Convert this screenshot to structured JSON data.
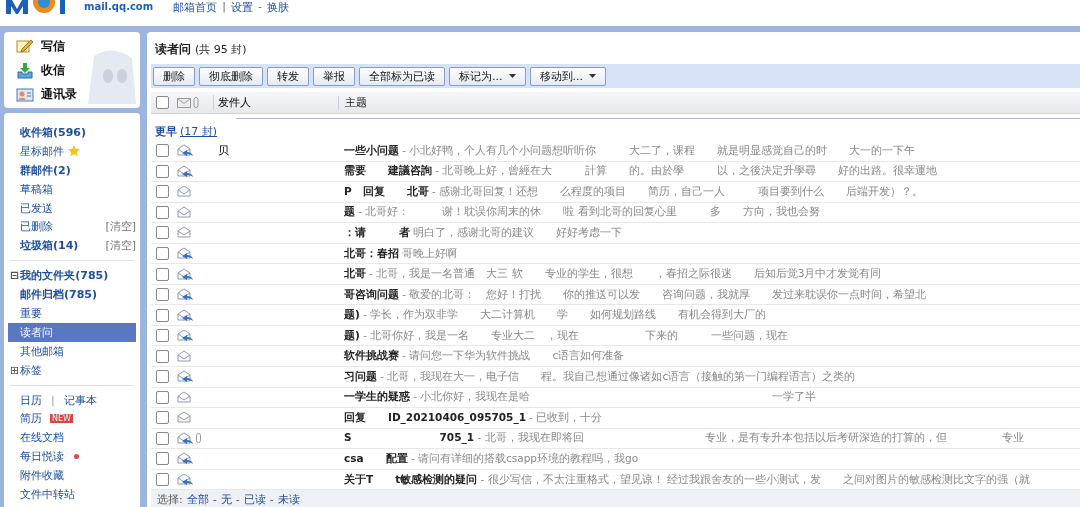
{
  "header": {
    "site": "mail.qq.com",
    "links": [
      "邮箱首页",
      "设置",
      "换肤"
    ],
    "separators": [
      "|",
      "-"
    ]
  },
  "compose": [
    {
      "kind": "write",
      "label": "写信"
    },
    {
      "kind": "receive",
      "label": "收信"
    },
    {
      "kind": "contacts",
      "label": "通讯录"
    }
  ],
  "folders": [
    {
      "label": "收件箱(596)",
      "unread": true,
      "selected": false
    },
    {
      "label": "星标邮件",
      "unread": false,
      "selected": false,
      "starred": true
    },
    {
      "label": "群邮件(2)",
      "unread": true,
      "selected": false
    },
    {
      "label": "草稿箱",
      "unread": false,
      "selected": false
    },
    {
      "label": "已发送",
      "unread": false,
      "selected": false
    },
    {
      "label": "已删除",
      "unread": false,
      "selected": false,
      "action": "[清空]"
    },
    {
      "label": "垃圾箱(14)",
      "unread": true,
      "selected": false,
      "action": "[清空]"
    }
  ],
  "my_folders": [
    {
      "label": "我的文件夹(785)",
      "unread": true,
      "selected": false,
      "toggle": "⊟",
      "children": [
        {
          "label": "邮件归档(785)",
          "unread": true,
          "selected": false
        },
        {
          "label": "重要",
          "unread": false,
          "selected": false
        },
        {
          "label": "读者问",
          "unread": false,
          "selected": true
        }
      ]
    },
    {
      "label": "其他邮箱",
      "unread": false,
      "selected": false
    },
    {
      "label": "标签",
      "unread": false,
      "selected": false,
      "toggle": "⊞"
    }
  ],
  "tools": [
    {
      "links": [
        "日历",
        "记事本"
      ],
      "separator": "|"
    },
    {
      "links": [
        "简历"
      ],
      "badge": "NEW"
    },
    {
      "links": [
        "在线文档"
      ]
    },
    {
      "links": [
        "每日悦读"
      ],
      "dot": true
    },
    {
      "links": [
        "附件收藏"
      ]
    },
    {
      "links": [
        "文件中转站"
      ]
    }
  ],
  "folder_title": {
    "name": "读者问",
    "count": "(共 95 封)"
  },
  "toolbar": [
    {
      "label": "删除"
    },
    {
      "label": "彻底删除"
    },
    {
      "label": "转发"
    },
    {
      "label": "举报"
    },
    {
      "label": "全部标为已读"
    },
    {
      "label": "标记为...",
      "dropdown": true
    },
    {
      "label": "移动到...",
      "dropdown": true
    }
  ],
  "select_all": {
    "checked": false
  },
  "columns": [
    "发件人",
    "主题"
  ],
  "group": {
    "label": "更早",
    "count": "(17 封)"
  },
  "rows": [
    {
      "checked": false,
      "sender": "贝",
      "subject": "一些小问题",
      "preview": "- 小北好鸭，个人有几个小问题想听听你　　　大二了，课程　　就是明显感觉自己的时　　大一的一下午",
      "replied": true,
      "attachment": false
    },
    {
      "checked": false,
      "subject": "需要　　建議咨詢",
      "preview": "- 北哥晚上好，曾經在大　　　計算　　的。由於學　　　以，之後決定升學尋　　好的出路。很幸運地",
      "replied": true,
      "attachment": false
    },
    {
      "checked": false,
      "subject": "P　回复　　北哥",
      "preview": "- 感谢北哥回复！还想　　么程度的项目　　简历，自己一人　　　项目要到什么　　后端开发）？。",
      "replied": false,
      "attachment": false
    },
    {
      "checked": false,
      "subject": "题",
      "preview": "- 北哥好：　　　谢！耽误你周末的休　　啦 看到北哥的回复心里　　　多　　方向，我也会努",
      "replied": false,
      "attachment": false
    },
    {
      "checked": false,
      "subject": "：请　　　者",
      "preview": "明白了，感谢北哥的建议　　好好考虑一下",
      "replied": false,
      "attachment": false
    },
    {
      "checked": false,
      "subject": "北哥：春招",
      "preview": "哥晚上好啊",
      "replied": true,
      "attachment": false
    },
    {
      "checked": false,
      "subject": "北哥",
      "preview": "- 北哥，我是一名普通　大三 软　　专业的学生，很想　　，春招之际很迷　　后知后觉3月中才发觉有同",
      "replied": true,
      "attachment": false
    },
    {
      "checked": false,
      "subject": "哥咨询问题",
      "preview": "- 敬爱的北哥：　您好！打扰　　你的推送可以发　　咨询问题，我就厚　　发过来耽误你一点时间，希望北",
      "replied": true,
      "attachment": false
    },
    {
      "checked": false,
      "subject": "题)",
      "preview": "- 学长，作为双非学　　大二计算机　　学　　如何规划路线　　有机会得到大厂的",
      "replied": true,
      "attachment": false
    },
    {
      "checked": false,
      "subject": "题)",
      "preview": "- 北哥你好，我是一名　　专业大二　，现在　　　　　　下来的　　　一些问题，现在",
      "replied": true,
      "attachment": false
    },
    {
      "checked": false,
      "subject": "软件挑战赛",
      "preview": "- 请问您一下华为软件挑战　　c语言如何准备",
      "replied": false,
      "attachment": false
    },
    {
      "checked": false,
      "subject": "习问题",
      "preview": "- 北哥，我现在大一，电子信　　程。我自己想通过像诸如c语言（接触的第一门编程语言）之类的",
      "replied": true,
      "attachment": false
    },
    {
      "checked": false,
      "subject": "一学生的疑惑",
      "preview": "- 小北你好，我现在是哈　　　　　　　　　　　　　　　　　　　　　　一学了半",
      "replied": false,
      "attachment": false
    },
    {
      "checked": false,
      "subject": "回复　　ID_20210406_095705_1",
      "preview": "- 已收到，十分",
      "replied": false,
      "attachment": false
    },
    {
      "checked": false,
      "subject": "S　　　　　　　　705_1",
      "preview": "- 北哥，我现在即将回　　　　　　　　　　　专业，是有专升本包括以后考研深造的打算的，但　　　　　专业",
      "replied": true,
      "attachment": true
    },
    {
      "checked": false,
      "subject": "csa　　配置",
      "preview": "- 请问有详细的搭载csapp环境的教程吗，我go",
      "replied": true,
      "attachment": false
    },
    {
      "checked": false,
      "subject": "关于T　　t敏感检测的疑问",
      "preview": "- 很少写信，不太注重格式，望见谅！ 经过我跟舍友的一些小测试，发　　之间对图片的敏感检测比文字的强（就",
      "replied": true,
      "attachment": false
    }
  ],
  "footer": {
    "label": "选择:",
    "links": [
      "全部",
      "无",
      "已读",
      "未读"
    ],
    "separator": "-"
  }
}
